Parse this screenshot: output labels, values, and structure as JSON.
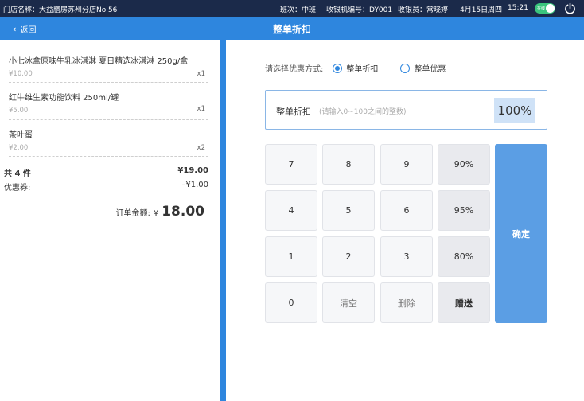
{
  "topbar": {
    "store_label": "门店名称：大益膳房苏州分店No.56",
    "shift": "班次：中班",
    "register": "收银机编号：DY001",
    "cashier": "收银员：常晓婷",
    "date": "4月15日",
    "weekday": "周四",
    "time": "15:21",
    "status_badge": "在线",
    "icons": {
      "power": "power-icon"
    }
  },
  "header": {
    "back_label": "返回",
    "title": "整单折扣"
  },
  "order": {
    "items": [
      {
        "name": "小七冰盒原味牛乳冰淇淋  夏日精选冰淇淋  250g/盒",
        "price": "¥10.00",
        "qty": "x1"
      },
      {
        "name": "红牛维生素功能饮料 250ml/罐",
        "price": "¥5.00",
        "qty": "x1"
      },
      {
        "name": "茶叶蛋",
        "price": "¥2.00",
        "qty": "x2"
      }
    ],
    "count_label": "共 4 件",
    "subtotal": "¥19.00",
    "coupon_label": "优惠券:",
    "coupon_value": "–¥1.00",
    "total_label": "订单金额:",
    "total_currency": "¥",
    "total_amount": "18.00"
  },
  "discount": {
    "mode_label": "请选择优惠方式:",
    "options": [
      {
        "label": "整单折扣",
        "selected": true
      },
      {
        "label": "整单优惠",
        "selected": false
      }
    ],
    "input_label": "整单折扣",
    "input_hint": "(请输入0~100之间的整数)",
    "input_value": "100%"
  },
  "keypad": {
    "keys": [
      "7",
      "8",
      "9",
      "90%",
      "4",
      "5",
      "6",
      "95%",
      "1",
      "2",
      "3",
      "80%",
      "0",
      "清空",
      "删除",
      "赠送"
    ],
    "confirm": "确定"
  },
  "colors": {
    "topbar_bg": "#1b2a4a",
    "header_bg": "#2e86de",
    "confirm_bg": "#5b9ee4",
    "status_green": "#3ac47d"
  }
}
